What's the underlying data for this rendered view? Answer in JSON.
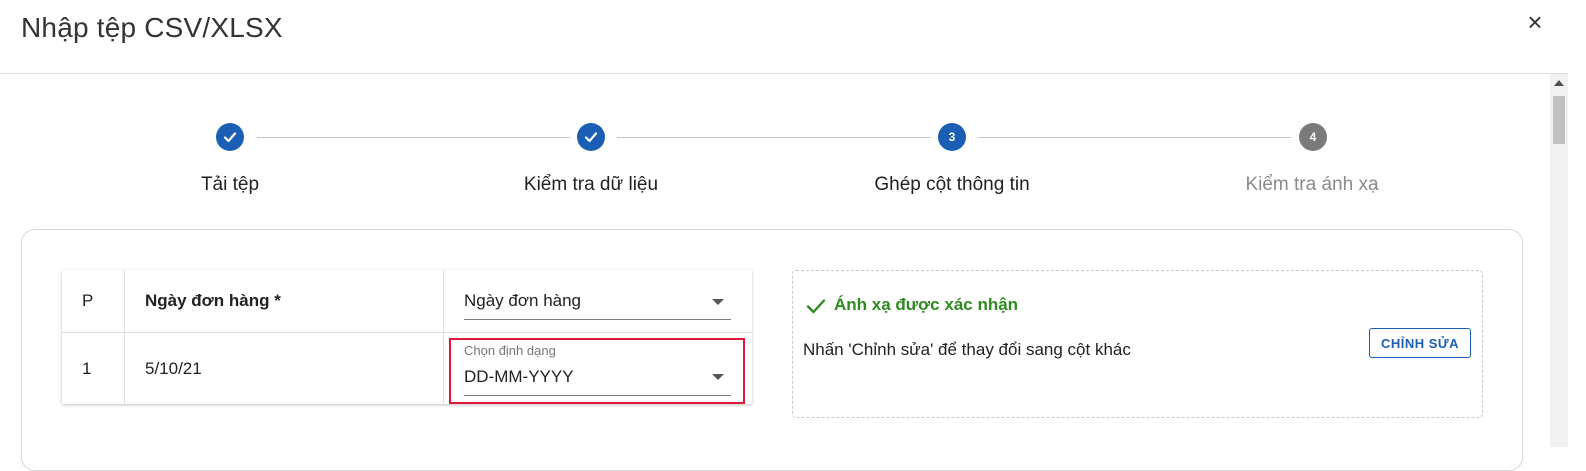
{
  "dialog": {
    "title": "Nhập tệp CSV/XLSX",
    "close_icon": "×"
  },
  "stepper": {
    "steps": [
      {
        "label": "Tải tệp",
        "state": "done",
        "marker": ""
      },
      {
        "label": "Kiểm tra dữ liệu",
        "state": "done",
        "marker": ""
      },
      {
        "label": "Ghép cột thông tin",
        "state": "active",
        "marker": "3"
      },
      {
        "label": "Kiểm tra ánh xạ",
        "state": "pending",
        "marker": "4"
      }
    ]
  },
  "mapping_table": {
    "header": {
      "col_p": "P",
      "col_name": "Ngày đơn hàng *",
      "column_select": "Ngày đơn hàng"
    },
    "row": {
      "index": "1",
      "value": "5/10/21",
      "format_label": "Chọn định dạng",
      "format_value": "DD-MM-YYYY"
    }
  },
  "confirm_panel": {
    "title": "Ánh xạ được xác nhận",
    "hint": "Nhấn 'Chỉnh sửa' để thay đổi sang cột khác",
    "edit_button": "CHỈNH SỬA"
  },
  "colors": {
    "primary": "#1a5fb4",
    "success": "#2e8b1f",
    "highlight": "#e0173b",
    "pending": "#7a7a7a"
  },
  "icons": {
    "close": "close-icon",
    "check": "check-icon",
    "dropdown": "chevron-down-icon"
  }
}
